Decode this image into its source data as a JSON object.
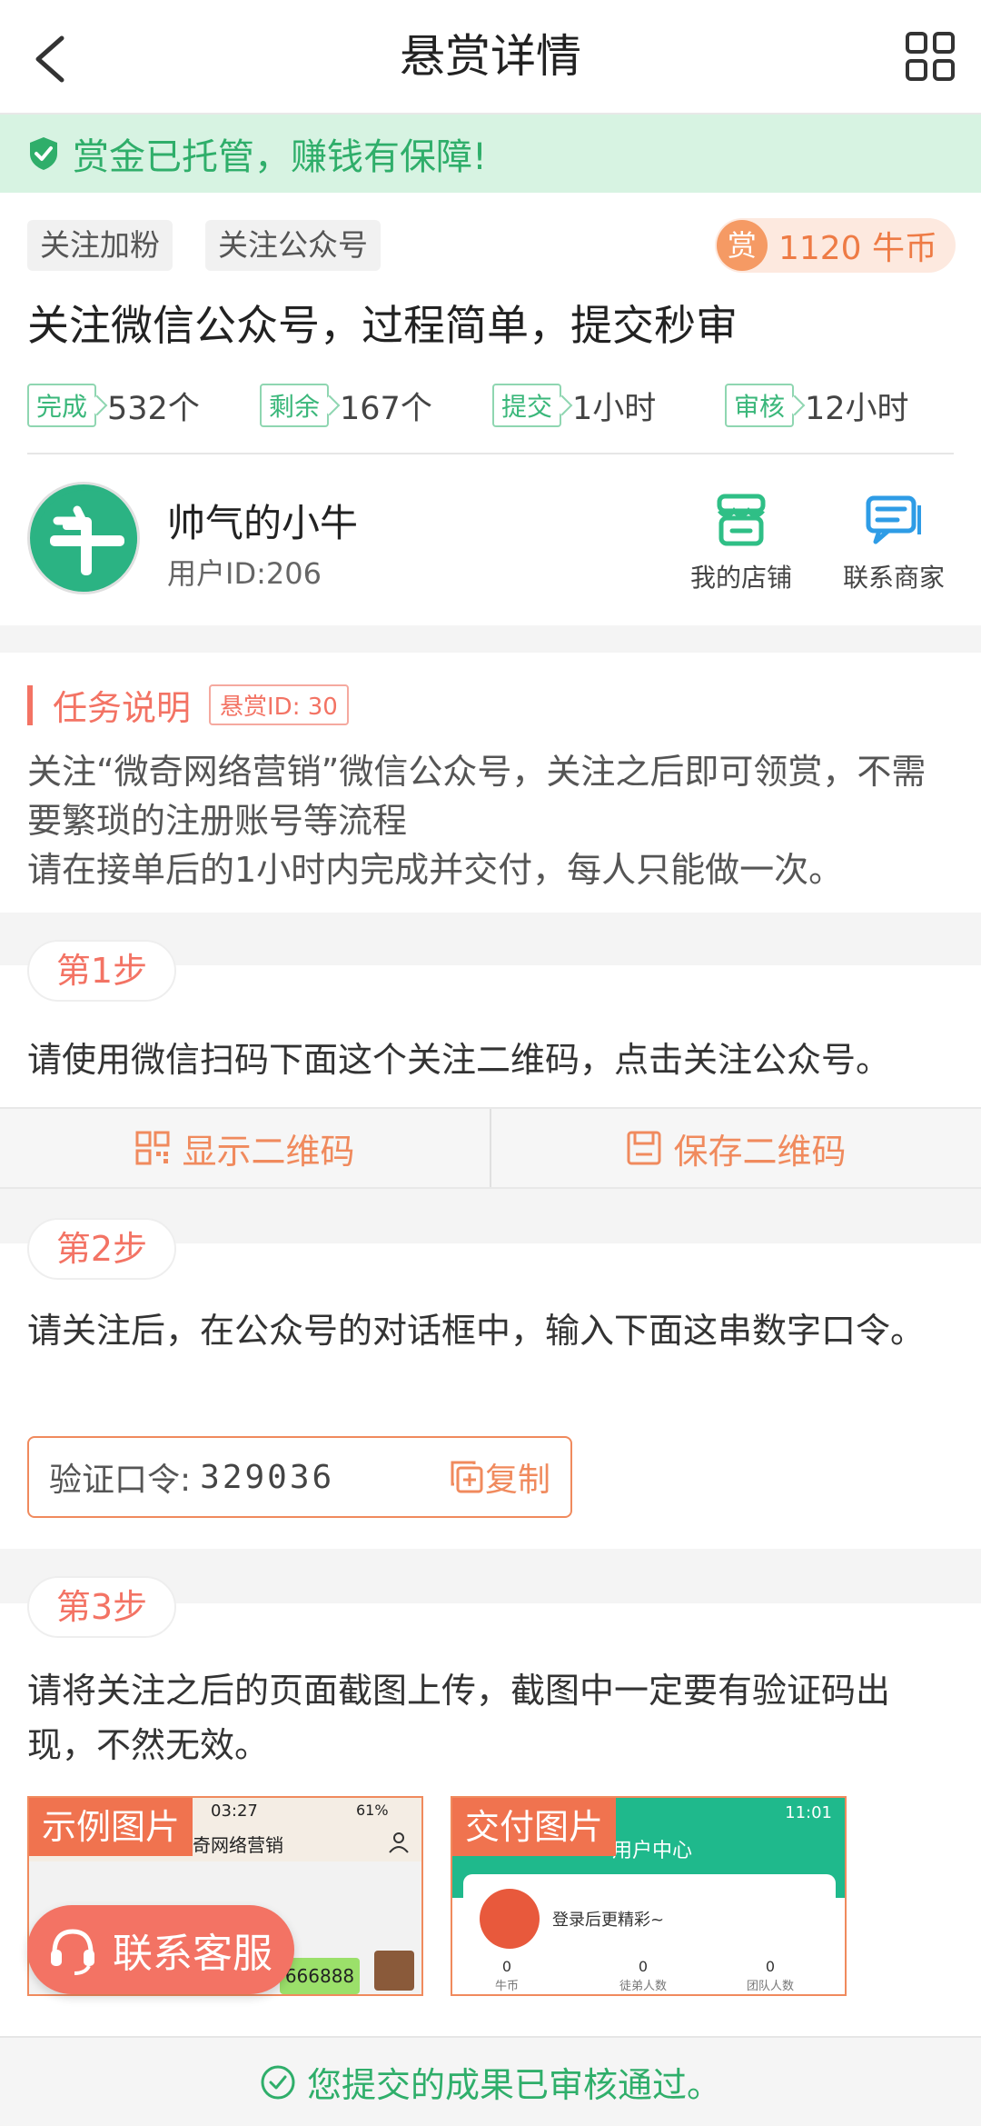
{
  "header": {
    "title": "悬赏详情"
  },
  "banner": {
    "text": "赏金已托管，赚钱有保障!"
  },
  "task": {
    "tags": [
      "关注加粉",
      "关注公众号"
    ],
    "reward_badge": "赏",
    "reward_amount": "1120 牛币",
    "title": "关注微信公众号，过程简单，提交秒审",
    "stats": [
      {
        "label": "完成",
        "value": "532个"
      },
      {
        "label": "剩余",
        "value": "167个"
      },
      {
        "label": "提交",
        "value": "1小时"
      },
      {
        "label": "审核",
        "value": "12小时"
      }
    ]
  },
  "merchant": {
    "name": "帅气的小牛",
    "user_id": "用户ID:206",
    "shop_label": "我的店铺",
    "contact_label": "联系商家"
  },
  "description": {
    "heading": "任务说明",
    "bounty_id": "悬赏ID: 30",
    "line1": "关注“微奇网络营销”微信公众号，关注之后即可领赏，不需要繁琐的注册账号等流程",
    "line2": "请在接单后的1小时内完成并交付，每人只能做一次。"
  },
  "steps": [
    {
      "label": "第1步",
      "text": "请使用微信扫码下面这个关注二维码，点击关注公众号。"
    },
    {
      "label": "第2步",
      "text": "请关注后，在公众号的对话框中，输入下面这串数字口令。"
    },
    {
      "label": "第3步",
      "text": "请将关注之后的页面截图上传，截图中一定要有验证码出现，不然无效。"
    }
  ],
  "qr": {
    "show_label": "显示二维码",
    "save_label": "保存二维码"
  },
  "code": {
    "label": "验证口令:",
    "value": "329036",
    "copy_label": "复制"
  },
  "images": {
    "example_label": "示例图片",
    "delivery_label": "交付图片",
    "example_time": "03:27",
    "example_battery": "61%",
    "example_account": "奇网络营销",
    "example_chat_code": "666888",
    "delivery_time": "11:01",
    "delivery_header": "用户中心",
    "delivery_login": "登录后更精彩~",
    "delivery_stats": [
      {
        "value": "0",
        "label": "牛币"
      },
      {
        "value": "0",
        "label": "徒弟人数"
      },
      {
        "value": "0",
        "label": "团队人数"
      }
    ]
  },
  "customer_service": {
    "label": "联系客服"
  },
  "footer": {
    "status": "您提交的成果已审核通过。"
  },
  "colors": {
    "accent": "#f37364",
    "green": "#2fae6a",
    "orange": "#f08a5d"
  }
}
